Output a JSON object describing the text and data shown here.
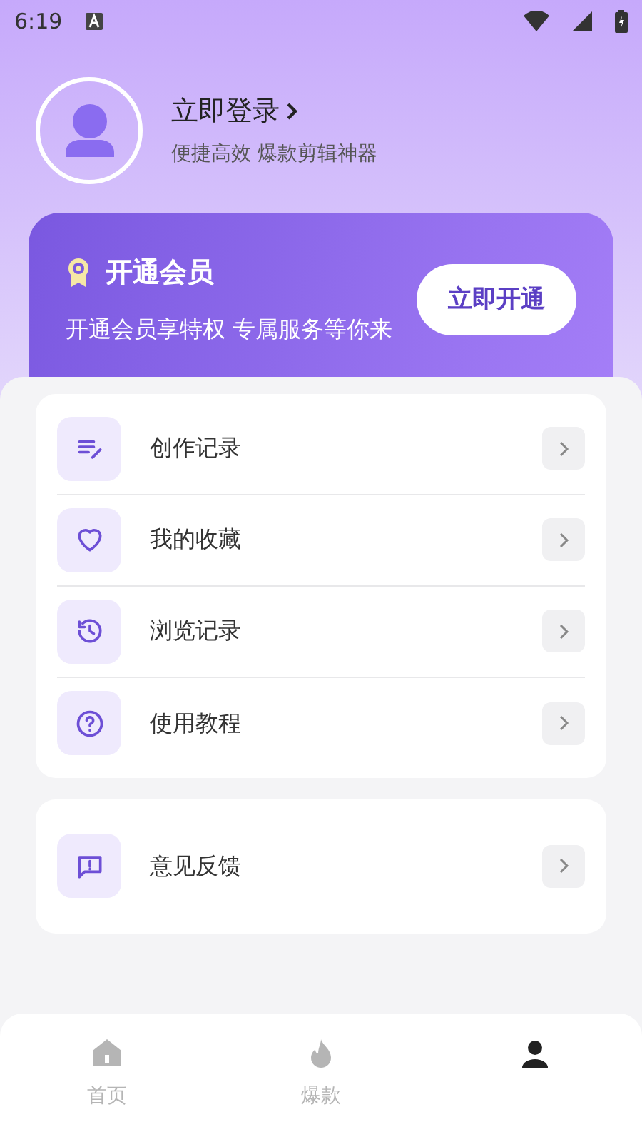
{
  "status_bar": {
    "time": "6:19"
  },
  "profile": {
    "login": "立即登录",
    "tagline": "便捷高效 爆款剪辑神器"
  },
  "vip": {
    "title": "开通会员",
    "description": "开通会员享特权 专属服务等你来",
    "button": "立即开通"
  },
  "menu_groups": [
    {
      "items": [
        {
          "kind": "edit",
          "label": "创作记录"
        },
        {
          "kind": "heart",
          "label": "我的收藏"
        },
        {
          "kind": "history",
          "label": "浏览记录"
        },
        {
          "kind": "help",
          "label": "使用教程"
        }
      ]
    },
    {
      "items": [
        {
          "kind": "feedback",
          "label": "意见反馈"
        }
      ]
    }
  ],
  "tab_bar": [
    {
      "kind": "home",
      "label": "首页",
      "selected": false
    },
    {
      "kind": "fire",
      "label": "爆款",
      "selected": false
    },
    {
      "kind": "user",
      "selected": true
    }
  ]
}
